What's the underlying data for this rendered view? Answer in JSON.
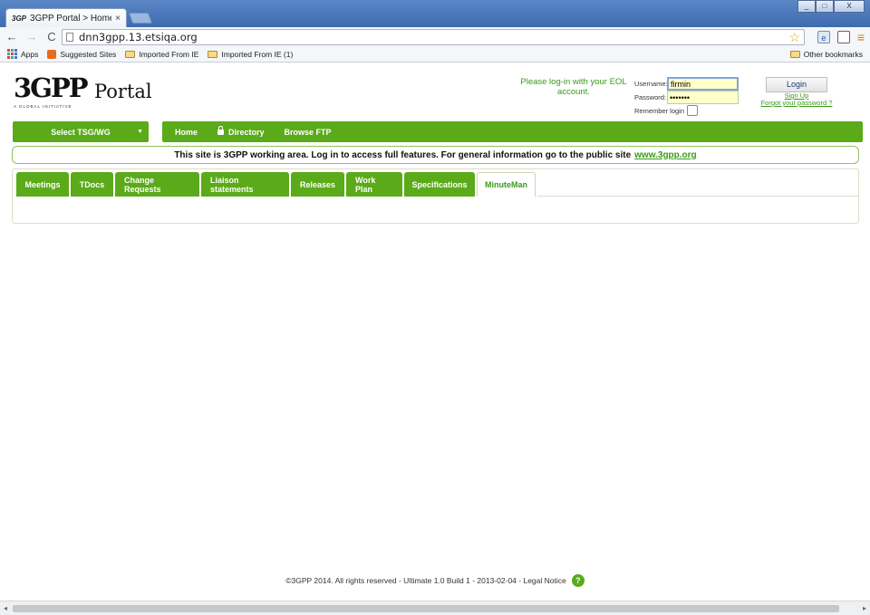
{
  "browser": {
    "tab_favicon": "3GP",
    "tab_title": "3GPP Portal > Home",
    "tab_close": "×",
    "window_buttons": [
      "_",
      "□",
      "X"
    ],
    "nav": {
      "back": "←",
      "forward": "→",
      "reload": "C"
    },
    "url": "dnn3gpp.13.etsiqa.org",
    "star": "☆",
    "menu": "≡",
    "bookmarks": {
      "apps": "Apps",
      "suggested": "Suggested Sites",
      "imported1": "Imported From IE",
      "imported2": "Imported From IE (1)",
      "other": "Other bookmarks"
    }
  },
  "header": {
    "logo_mark": "3GPP",
    "logo_tagline": "A GLOBAL INITIATIVE",
    "portal_word": "Portal"
  },
  "login": {
    "message": "Please log-in with your EOL account.",
    "username_label": "Username:",
    "username_value": "firmin",
    "password_label": "Password:",
    "password_value": "•••••••",
    "remember_label": "Remember login",
    "login_button": "Login",
    "sign_up": "Sign Up",
    "forgot": "Forgot your password ?"
  },
  "nav": {
    "select_label": "Select TSG/WG",
    "caret": "▼",
    "items": [
      "Home",
      "Directory",
      "Browse FTP"
    ]
  },
  "notice": {
    "text": "This site is 3GPP working area. Log in to access full features. For general information go to the public site",
    "link": "www.3gpp.org"
  },
  "tabs": [
    {
      "label": "Meetings"
    },
    {
      "label": "TDocs"
    },
    {
      "label": "Change Requests"
    },
    {
      "label": "Liaison statements"
    },
    {
      "label": "Releases"
    },
    {
      "label": "Work Plan"
    },
    {
      "label": "Specifications"
    },
    {
      "label": "MinuteMan"
    }
  ],
  "footer": {
    "text": "©3GPP 2014. All rights reserved - Ultimate 1.0 Build 1 - 2013-02-04 - Legal Notice",
    "help": "?"
  },
  "colors": {
    "accent_green": "#5aaa1a",
    "link_green": "#3a9b18",
    "titlebar_blue": "#4a77bb"
  },
  "icons": [
    "back-icon",
    "forward-icon",
    "reload-icon",
    "page-icon",
    "star-icon",
    "menu-icon",
    "apps-icon",
    "folder-icon",
    "lock-icon",
    "help-icon"
  ]
}
